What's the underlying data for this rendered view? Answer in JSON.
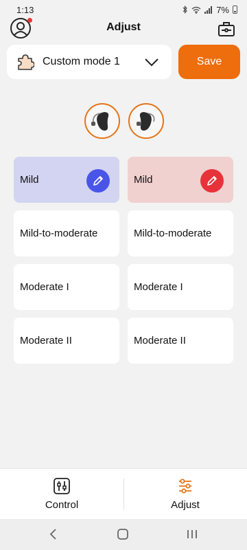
{
  "status_bar": {
    "time": "1:13",
    "battery": "7%"
  },
  "header": {
    "title": "Adjust"
  },
  "mode": {
    "selected": "Custom mode 1"
  },
  "save_label": "Save",
  "colors": {
    "accent": "#ee6d0c",
    "left_ear": "#4a55e8",
    "right_ear": "#e8323a",
    "left_selected_bg": "#d2d4f2",
    "right_selected_bg": "#f0d1cf"
  },
  "presets": {
    "left": [
      {
        "label": "Mild",
        "selected": true
      },
      {
        "label": "Mild-to-moderate",
        "selected": false
      },
      {
        "label": "Moderate I",
        "selected": false
      },
      {
        "label": "Moderate II",
        "selected": false
      }
    ],
    "right": [
      {
        "label": "Mild",
        "selected": true
      },
      {
        "label": "Mild-to-moderate",
        "selected": false
      },
      {
        "label": "Moderate I",
        "selected": false
      },
      {
        "label": "Moderate II",
        "selected": false
      }
    ]
  },
  "tabs": [
    {
      "label": "Control",
      "icon": "control-icon",
      "active": false
    },
    {
      "label": "Adjust",
      "icon": "sliders-icon",
      "active": true
    }
  ]
}
